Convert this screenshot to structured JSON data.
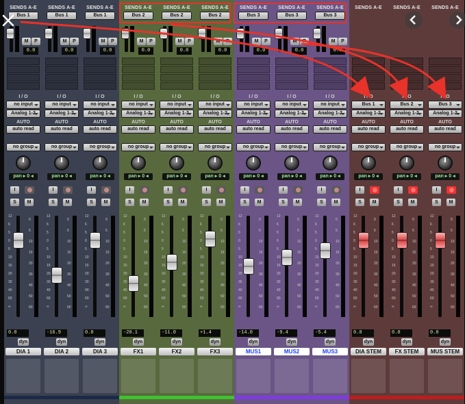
{
  "sends_header": "SENDS A-E",
  "io_label": "I / O",
  "auto_label": "AUTO",
  "dyn_label": "dyn",
  "m_label": "M",
  "p_label": "P",
  "i_label": "I",
  "s_label": "S",
  "solo_label": "M",
  "pan_value": "pan ▸ 0 ◂",
  "strips": [
    {
      "name": "DIA 1",
      "send": "Bus 1",
      "send_value": "0.0",
      "input": "no input",
      "output": "Analog 1-2",
      "automation": "auto read",
      "group": "no group",
      "volume": "0.0",
      "group_color": "#1b2a48",
      "name_style": "normal",
      "record_on": false,
      "fader_pos": 0.2
    },
    {
      "name": "DIA 2",
      "send": "Bus 1",
      "send_value": "0.0",
      "input": "no input",
      "output": "Analog 1-2",
      "automation": "auto read",
      "group": "no group",
      "volume": "-16.9",
      "group_color": "#1b2a48",
      "name_style": "normal",
      "record_on": false,
      "fader_pos": 0.6
    },
    {
      "name": "DIA 3",
      "send": "Bus 1",
      "send_value": "0.0",
      "input": "no input",
      "output": "Analog 1-2",
      "automation": "auto read",
      "group": "no group",
      "volume": "0.0",
      "group_color": "#1b2a48",
      "name_style": "normal",
      "record_on": false,
      "fader_pos": 0.2
    },
    {
      "name": "FX1",
      "send": "Bus 2",
      "send_value": "0.0",
      "input": "no input",
      "output": "Analog 1-2",
      "automation": "auto read",
      "group": "no group",
      "volume": "-20.1",
      "group_color": "#3ec22f",
      "name_style": "normal",
      "record_on": false,
      "fader_pos": 0.7
    },
    {
      "name": "FX2",
      "send": "Bus 2",
      "send_value": "0.0",
      "input": "no input",
      "output": "Analog 1-2",
      "automation": "auto read",
      "group": "no group",
      "volume": "-11.0",
      "group_color": "#3ec22f",
      "name_style": "normal",
      "record_on": false,
      "fader_pos": 0.45
    },
    {
      "name": "FX3",
      "send": "Bus 2",
      "send_value": "0.0",
      "input": "no input",
      "output": "Analog 1-2",
      "automation": "auto read",
      "group": "no group",
      "volume": "+1.4",
      "group_color": "#3ec22f",
      "name_style": "normal",
      "record_on": false,
      "fader_pos": 0.18
    },
    {
      "name": "MUS1",
      "send": "Bus 3",
      "send_value": "0.0",
      "input": "no input",
      "output": "Analog 1-2",
      "automation": "auto read",
      "group": "no group",
      "volume": "-14.0",
      "group_color": "#7e3ce0",
      "name_style": "white",
      "record_on": false,
      "fader_pos": 0.5
    },
    {
      "name": "MUS2",
      "send": "Bus 3",
      "send_value": "0.0",
      "input": "no input",
      "output": "Analog 1-2",
      "automation": "auto read",
      "group": "no group",
      "volume": "-9.4",
      "group_color": "#7e3ce0",
      "name_style": "white",
      "record_on": false,
      "fader_pos": 0.4
    },
    {
      "name": "MUS3",
      "send": "Bus 3",
      "send_value": "0.0",
      "input": "no input",
      "output": "Analog 1-2",
      "automation": "auto read",
      "group": "no group",
      "volume": "-5.4",
      "group_color": "#7e3ce0",
      "name_style": "white",
      "record_on": false,
      "fader_pos": 0.32
    },
    {
      "name": "DIA STEM",
      "send": "",
      "send_value": "",
      "input": "Bus 1",
      "output": "Analog 1-2",
      "automation": "auto read",
      "group": "no group",
      "volume": "0.0",
      "group_color": "#c01c1c",
      "name_style": "normal",
      "record_on": true,
      "fader_pos": 0.2
    },
    {
      "name": "FX STEM",
      "send": "",
      "send_value": "",
      "input": "Bus 2",
      "output": "Analog 1-2",
      "automation": "auto read",
      "group": "no group",
      "volume": "0.0",
      "group_color": "#c01c1c",
      "name_style": "normal",
      "record_on": true,
      "fader_pos": 0.2
    },
    {
      "name": "MUS STEM",
      "send": "",
      "send_value": "",
      "input": "Bus 3",
      "output": "Analog 1-2",
      "automation": "auto read",
      "group": "no group",
      "volume": "0.0",
      "group_color": "#c01c1c",
      "name_style": "normal",
      "record_on": true,
      "fader_pos": 0.2
    }
  ],
  "strip_colors": [
    "#3b4150",
    "#3b4150",
    "#3b4150",
    "#58693e",
    "#58693e",
    "#58693e",
    "#6a5586",
    "#6a5586",
    "#6a5586",
    "#5e3b3b",
    "#5e3b3b",
    "#5e3b3b"
  ],
  "fader_scale": [
    "12",
    "6",
    "5",
    "0",
    "5",
    "10",
    "15",
    "20",
    "30",
    "40",
    "60",
    "∞"
  ],
  "meter_scale": [
    "0",
    "5",
    "10",
    "15",
    "20",
    "30",
    "40",
    "50",
    "60"
  ],
  "annotation_color": "#e8322a"
}
